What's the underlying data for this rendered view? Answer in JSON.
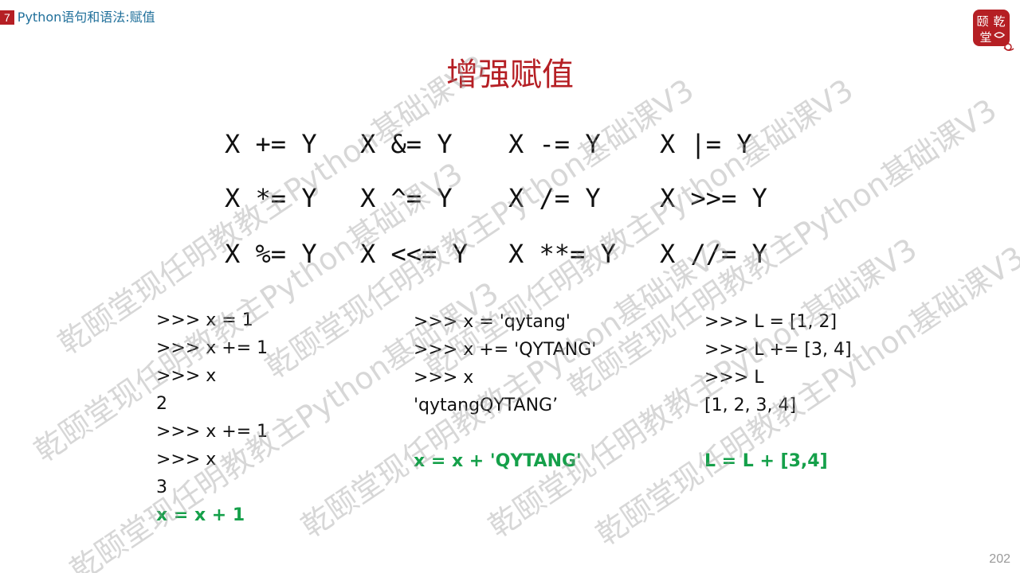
{
  "header": {
    "chapter_number": "7",
    "section_title": "Python语句和语法:赋值"
  },
  "logo": {
    "text": "乾颐堂",
    "color": "#b51f24"
  },
  "title": "增强赋值",
  "operators": [
    [
      "X += Y",
      "X &= Y",
      "X -= Y",
      "X |= Y"
    ],
    [
      "X *= Y",
      "X ^= Y",
      "X /= Y",
      "X >>= Y"
    ],
    [
      "X %= Y",
      "X <<= Y",
      "X **= Y",
      "X //= Y"
    ]
  ],
  "examples": {
    "left": {
      "lines": [
        ">>> x = 1",
        ">>> x += 1",
        ">>> x",
        "2",
        ">>> x += 1",
        ">>> x",
        "3"
      ],
      "equivalent": "x = x + 1"
    },
    "middle": {
      "lines": [
        ">>> x = 'qytang'",
        ">>> x += 'QYTANG'",
        ">>> x",
        "'qytangQYTANG’"
      ],
      "equivalent": "x = x + 'QYTANG'"
    },
    "right": {
      "lines": [
        ">>> L = [1, 2]",
        ">>> L += [3, 4]",
        ">>> L",
        "[1, 2, 3, 4]"
      ],
      "equivalent": "L = L + [3,4]"
    }
  },
  "watermark": "乾颐堂现任明教教主Python基础课V3",
  "page_number": "202",
  "colors": {
    "accent": "#b51f24",
    "header_text": "#1f6f9a",
    "equivalent_text": "#15a04a"
  }
}
